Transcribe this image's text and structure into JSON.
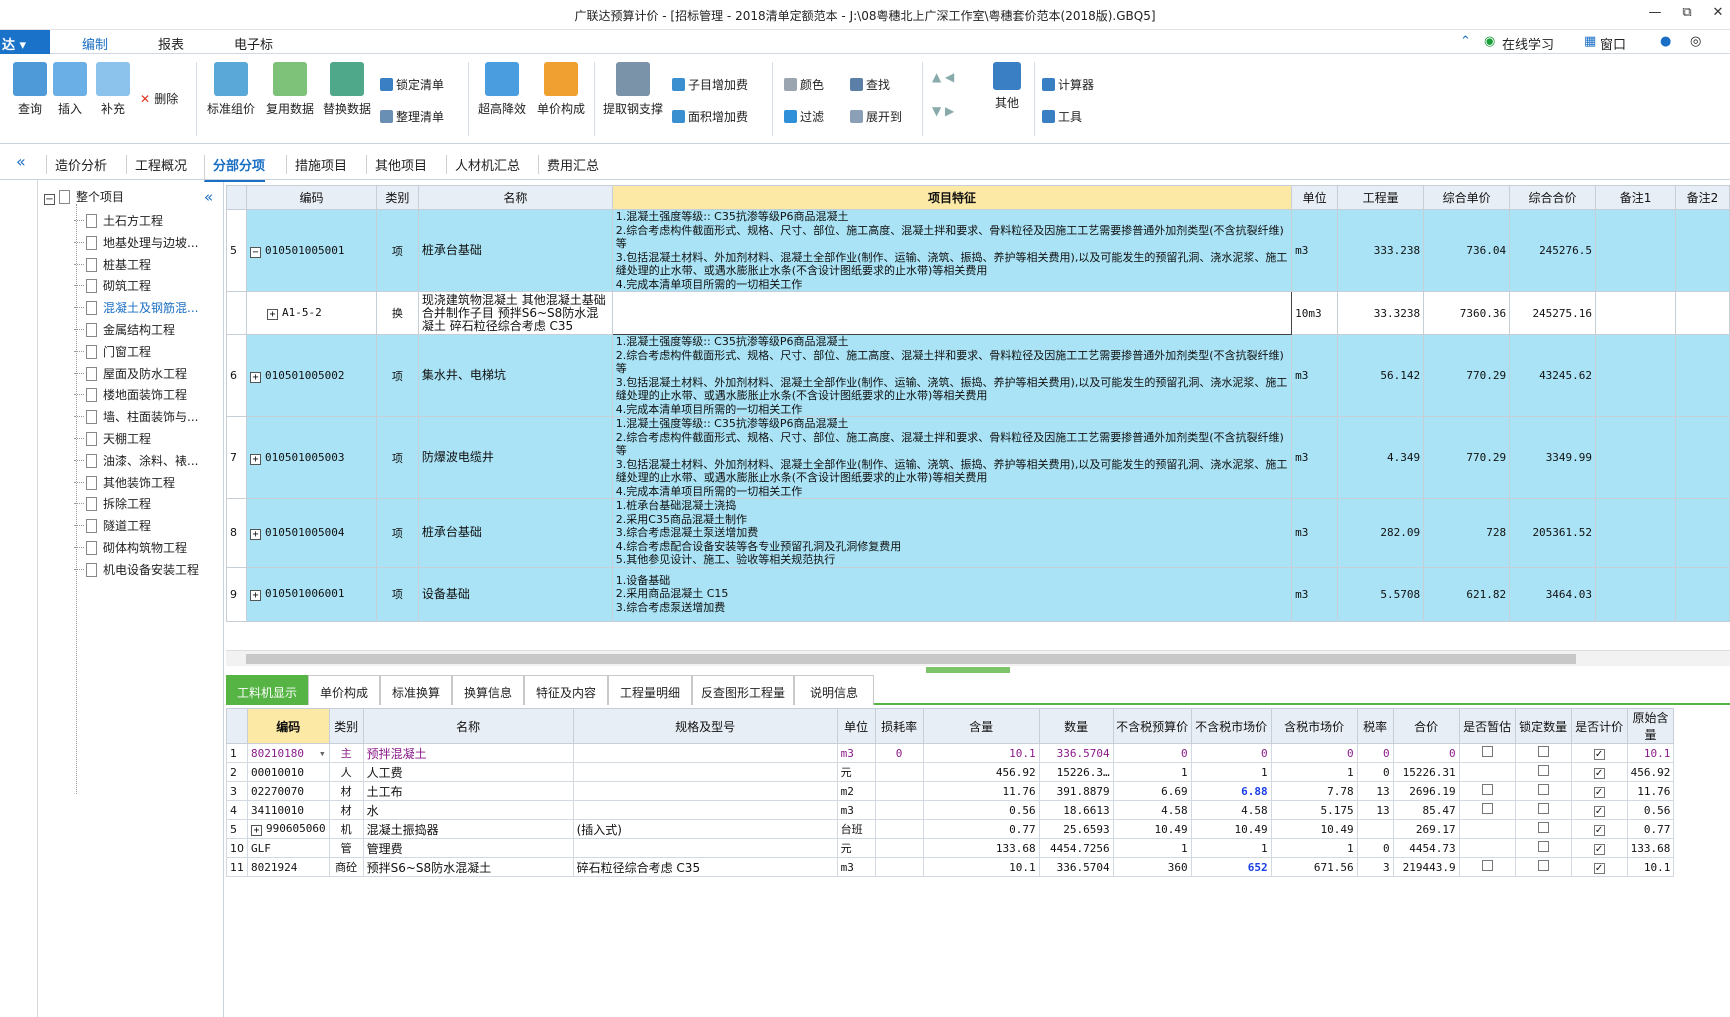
{
  "window": {
    "title": "广联达预算计价 - [招标管理 - 2018清单定额范本 - J:\\08粤穗北上广深工作室\\粤穗套价范本(2018版).GBQ5]",
    "minimize": "—",
    "restore": "⧉",
    "close": "✕"
  },
  "app_button": "达 ▾",
  "ribbon_tabs": [
    "编制",
    "报表",
    "电子标"
  ],
  "ribbon_right": {
    "online": "在线学习",
    "window": "窗口"
  },
  "ribbon": {
    "query": "查询",
    "insert": "插入",
    "supplement": "补充",
    "delete": "删除",
    "std_group": "标准组价",
    "reuse": "复用数据",
    "replace": "替换数据",
    "lock_list": "锁定清单",
    "tidy_list": "整理清单",
    "superhigh": "超高降效",
    "unit_comp": "单价构成",
    "extract_rebar": "提取钢支撑",
    "child_add": "子目增加费",
    "area_add": "面积增加费",
    "color": "颜色",
    "find": "查找",
    "filter": "过滤",
    "expand": "展开到",
    "other": "其他",
    "calculator": "计算器",
    "tools": "工具"
  },
  "page_tabs": [
    "造价分析",
    "工程概况",
    "分部分项",
    "措施项目",
    "其他项目",
    "人材机汇总",
    "费用汇总"
  ],
  "tree": {
    "root": "整个项目",
    "items": [
      "土石方工程",
      "地基处理与边坡...",
      "桩基工程",
      "砌筑工程",
      "混凝土及钢筋混...",
      "金属结构工程",
      "门窗工程",
      "屋面及防水工程",
      "楼地面装饰工程",
      "墙、柱面装饰与...",
      "天棚工程",
      "油漆、涂料、裱...",
      "其他装饰工程",
      "拆除工程",
      "隧道工程",
      "砌体构筑物工程",
      "机电设备安装工程"
    ],
    "selected": 4
  },
  "top_grid": {
    "headers": [
      "",
      "编码",
      "类别",
      "名称",
      "项目特征",
      "单位",
      "工程量",
      "综合单价",
      "综合合价",
      "备注1",
      "备注2"
    ],
    "rows": [
      {
        "idx": "5",
        "code": "010501005001",
        "type": "项",
        "name": "桩承台基础",
        "feat": "1.混凝土强度等级:: C35抗渗等级P6商品混凝土\n2.综合考虑构件截面形式、规格、尺寸、部位、施工高度、混凝土拌和要求、骨料粒径及因施工工艺需要掺普通外加剂类型(不含抗裂纤维)等\n3.包括混凝土材料、外加剂材料、混凝土全部作业(制作、运输、浇筑、振捣、养护等相关费用),以及可能发生的预留孔洞、浇水泥浆、施工缝处理的止水带、或遇水膨胀止水条(不含设计图纸要求的止水带)等相关费用\n4.完成本清单项目所需的一切相关工作",
        "unit": "m3",
        "qty": "333.238",
        "price": "736.04",
        "total": "245276.5",
        "pm": "−",
        "hl": true
      },
      {
        "idx": "",
        "code": "A1-5-2",
        "type": "换",
        "name": "现浇建筑物混凝土 其他混凝土基础 合并制作子目 预拌S6~S8防水混凝土 碎石粒径综合考虑 C35",
        "feat": "",
        "unit": "10m3",
        "qty": "33.3238",
        "price": "7360.36",
        "total": "245275.16",
        "pm": "+",
        "hl": false
      },
      {
        "idx": "6",
        "code": "010501005002",
        "type": "项",
        "name": "集水井、电梯坑",
        "feat": "1.混凝土强度等级:: C35抗渗等级P6商品混凝土\n2.综合考虑构件截面形式、规格、尺寸、部位、施工高度、混凝土拌和要求、骨料粒径及因施工工艺需要掺普通外加剂类型(不含抗裂纤维)等\n3.包括混凝土材料、外加剂材料、混凝土全部作业(制作、运输、浇筑、振捣、养护等相关费用),以及可能发生的预留孔洞、浇水泥浆、施工缝处理的止水带、或遇水膨胀止水条(不含设计图纸要求的止水带)等相关费用\n4.完成本清单项目所需的一切相关工作",
        "unit": "m3",
        "qty": "56.142",
        "price": "770.29",
        "total": "43245.62",
        "pm": "+",
        "hl": true
      },
      {
        "idx": "7",
        "code": "010501005003",
        "type": "项",
        "name": "防爆波电缆井",
        "feat": "1.混凝土强度等级:: C35抗渗等级P6商品混凝土\n2.综合考虑构件截面形式、规格、尺寸、部位、施工高度、混凝土拌和要求、骨料粒径及因施工工艺需要掺普通外加剂类型(不含抗裂纤维)等\n3.包括混凝土材料、外加剂材料、混凝土全部作业(制作、运输、浇筑、振捣、养护等相关费用),以及可能发生的预留孔洞、浇水泥浆、施工缝处理的止水带、或遇水膨胀止水条(不含设计图纸要求的止水带)等相关费用\n4.完成本清单项目所需的一切相关工作",
        "unit": "m3",
        "qty": "4.349",
        "price": "770.29",
        "total": "3349.99",
        "pm": "+",
        "hl": true
      },
      {
        "idx": "8",
        "code": "010501005004",
        "type": "项",
        "name": "桩承台基础",
        "feat": "1.桩承台基础混凝土浇捣\n2.采用C35商品混凝土制作\n3.综合考虑混凝土泵送增加费\n4.综合考虑配合设备安装等各专业预留孔洞及孔洞修复费用\n5.其他参见设计、施工、验收等相关规范执行",
        "unit": "m3",
        "qty": "282.09",
        "price": "728",
        "total": "205361.52",
        "pm": "+",
        "hl": true
      },
      {
        "idx": "9",
        "code": "010501006001",
        "type": "项",
        "name": "设备基础",
        "feat": "1.设备基础\n2.采用商品混凝土 C15\n3.综合考虑泵送增加费",
        "unit": "m3",
        "qty": "5.5708",
        "price": "621.82",
        "total": "3464.03",
        "pm": "+",
        "hl": true
      }
    ]
  },
  "bottom_tabs": [
    "工料机显示",
    "单价构成",
    "标准换算",
    "换算信息",
    "特征及内容",
    "工程量明细",
    "反查图形工程量",
    "说明信息"
  ],
  "bottom_grid": {
    "headers": [
      "",
      "编码",
      "类别",
      "名称",
      "规格及型号",
      "单位",
      "损耗率",
      "含量",
      "数量",
      "不含税预算价",
      "不含税市场价",
      "含税市场价",
      "税率",
      "合价",
      "是否暂估",
      "锁定数量",
      "是否计价",
      "原始含量"
    ],
    "rows": [
      {
        "i": "1",
        "code": "80210180",
        "type": "主",
        "name": "预拌混凝土",
        "spec": "",
        "unit": "m3",
        "loss": "0",
        "amt": "10.1",
        "qty": "336.5704",
        "p1": "0",
        "p2": "0",
        "p3": "0",
        "tax": "0",
        "total": "0",
        "est": true,
        "lock": true,
        "calc": true,
        "orig": "10.1",
        "purple": true
      },
      {
        "i": "2",
        "code": "00010010",
        "type": "人",
        "name": "人工费",
        "spec": "",
        "unit": "元",
        "loss": "",
        "amt": "456.92",
        "qty": "15226.3…",
        "p1": "1",
        "p2": "1",
        "p3": "1",
        "tax": "0",
        "total": "15226.31",
        "est": false,
        "lock": true,
        "calc": true,
        "orig": "456.92"
      },
      {
        "i": "3",
        "code": "02270070",
        "type": "材",
        "name": "土工布",
        "spec": "",
        "unit": "m2",
        "loss": "",
        "amt": "11.76",
        "qty": "391.8879",
        "p1": "6.69",
        "p2": "6.88",
        "p3": "7.78",
        "tax": "13",
        "total": "2696.19",
        "est": true,
        "lock": true,
        "calc": true,
        "orig": "11.76",
        "blue": true
      },
      {
        "i": "4",
        "code": "34110010",
        "type": "材",
        "name": "水",
        "spec": "",
        "unit": "m3",
        "loss": "",
        "amt": "0.56",
        "qty": "18.6613",
        "p1": "4.58",
        "p2": "4.58",
        "p3": "5.175",
        "tax": "13",
        "total": "85.47",
        "est": true,
        "lock": true,
        "calc": true,
        "orig": "0.56"
      },
      {
        "i": "5",
        "code": "990605060",
        "type": "机",
        "name": "混凝土振捣器",
        "spec": "(插入式)",
        "unit": "台班",
        "loss": "",
        "amt": "0.77",
        "qty": "25.6593",
        "p1": "10.49",
        "p2": "10.49",
        "p3": "10.49",
        "tax": "",
        "total": "269.17",
        "est": false,
        "lock": true,
        "calc": true,
        "orig": "0.77",
        "pm": true
      },
      {
        "i": "10",
        "code": "GLF",
        "type": "管",
        "name": "管理费",
        "spec": "",
        "unit": "元",
        "loss": "",
        "amt": "133.68",
        "qty": "4454.7256",
        "p1": "1",
        "p2": "1",
        "p3": "1",
        "tax": "0",
        "total": "4454.73",
        "est": false,
        "lock": true,
        "calc": true,
        "orig": "133.68"
      },
      {
        "i": "11",
        "code": "8021924",
        "type": "商砼",
        "name": "预拌S6~S8防水混凝土",
        "spec": "碎石粒径综合考虑 C35",
        "unit": "m3",
        "loss": "",
        "amt": "10.1",
        "qty": "336.5704",
        "p1": "360",
        "p2": "652",
        "p3": "671.56",
        "tax": "3",
        "total": "219443.9",
        "est": true,
        "lock": true,
        "calc": true,
        "orig": "10.1",
        "blue": true
      }
    ]
  }
}
